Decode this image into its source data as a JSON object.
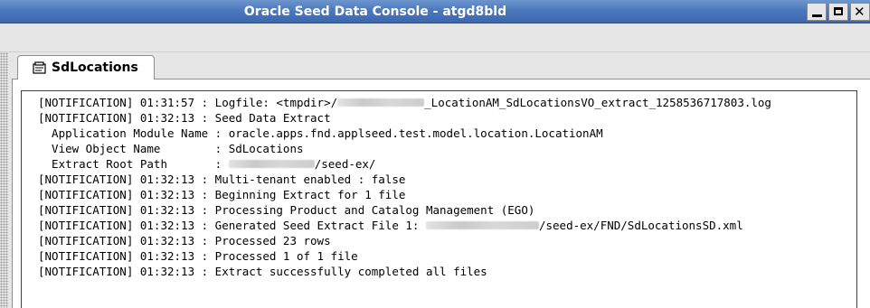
{
  "window": {
    "title": "Oracle Seed Data Console - atgd8bld",
    "minimize_icon": "minimize-icon",
    "maximize_icon": "maximize-icon",
    "close_icon": "close-icon"
  },
  "tabs": [
    {
      "label": "SdLocations",
      "icon": "tab-document-icon",
      "selected": true
    }
  ],
  "log": {
    "lines": [
      {
        "prefix": "[NOTIFICATION] 01:31:57 : Logfile: <tmpdir>/",
        "suffix": "_LocationAM_SdLocationsVO_extract_1258536717803.log"
      },
      {
        "text": "[NOTIFICATION] 01:32:13 : Seed Data Extract"
      },
      {
        "text": "  Application Module Name : oracle.apps.fnd.applseed.test.model.location.LocationAM"
      },
      {
        "text": "  View Object Name        : SdLocations"
      },
      {
        "prefix": "  Extract Root Path       : ",
        "suffix": "/seed-ex/"
      },
      {
        "text": "[NOTIFICATION] 01:32:13 : Multi-tenant enabled : false"
      },
      {
        "text": "[NOTIFICATION] 01:32:13 : Beginning Extract for 1 file"
      },
      {
        "text": "[NOTIFICATION] 01:32:13 : Processing Product and Catalog Management (EGO)"
      },
      {
        "prefix": "[NOTIFICATION] 01:32:13 : Generated Seed Extract File 1: ",
        "suffix": "/seed-ex/FND/SdLocationsSD.xml"
      },
      {
        "text": "[NOTIFICATION] 01:32:13 : Processed 23 rows"
      },
      {
        "text": "[NOTIFICATION] 01:32:13 : Processed 1 of 1 file"
      },
      {
        "text": "[NOTIFICATION] 01:32:13 : Extract successfully completed all files"
      }
    ]
  },
  "colors": {
    "titlebar": "#4c78bd",
    "window_bg": "#e6e6e6",
    "log_bg": "#ffffff"
  }
}
